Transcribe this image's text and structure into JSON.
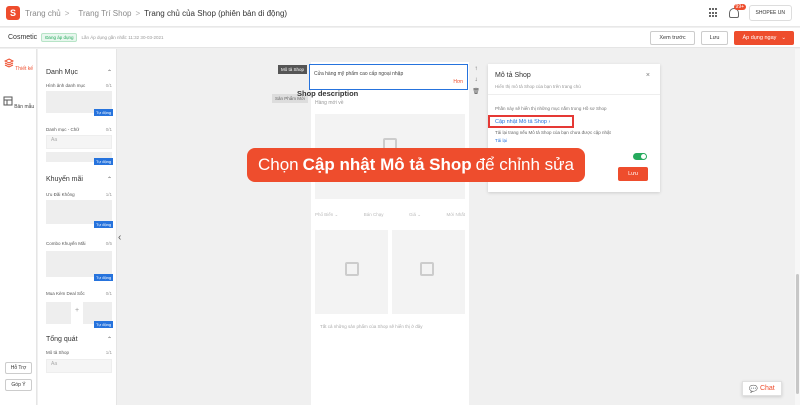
{
  "topbar": {
    "logo_glyph": "S",
    "crumbs": [
      "Trang chủ",
      "Trang Trí Shop",
      "Trang chủ của Shop (phiên bản di động)"
    ],
    "separator": ">",
    "notification_count": "99+",
    "user_label": "SHOPEE UN"
  },
  "subbar": {
    "theme_name": "Cosmetic",
    "applied_badge": "Đang áp dụng",
    "applied_time": "Lần Áp dụng gần nhất: 11:32 30-03-2021",
    "preview_label": "Xem trước",
    "save_label": "Lưu",
    "apply_label": "Áp dụng ngay",
    "apply_caret": "⌄"
  },
  "leftrail": {
    "design_label": "Thiết kế",
    "template_label": "Bản mẫu",
    "support_label": "Hỗ Trợ",
    "feedback_label": "Góp Ý"
  },
  "panel": {
    "categories_title": "Danh Mục",
    "caret": "⌃",
    "img_category_label": "Hình ảnh danh mục",
    "img_category_count": "0/1",
    "auto_tag": "Tự động",
    "category_text_label": "Danh mục - Chữ",
    "category_text_count": "0/1",
    "category_text_placeholder": "Aa",
    "promo_title": "Khuyến mãi",
    "voucher_label": "Ưu Đãi Không",
    "voucher_count": "1/1",
    "combo_label": "Combo Khuyến Mãi",
    "combo_count": "0/5",
    "deal_label": "Mua Kèm Deal Sốc",
    "deal_count": "0/1",
    "plus_sign": "+",
    "general_title": "Tổng quát",
    "shop_desc_label": "Mô tả Shop",
    "shop_desc_count": "1/1",
    "shop_desc_placeholder": "Aa",
    "collapse_glyph": "‹"
  },
  "canvas": {
    "desc_hover_label": "Mô tả Shop",
    "products_hover_label": "Sản Phẩm Mới",
    "desc_text": "Cửa hàng mỹ phẩm cao cấp ngoại nhập",
    "desc_more": "Hơn",
    "tool_up": "↑",
    "tool_down": "↓",
    "tool_delete": "🗑",
    "section_title": "Shop description",
    "new_label": "Hàng mới về",
    "filters": [
      "Phổ Biến ⌄",
      "Bán Chạy",
      "Giá ⌄",
      "Mới Nhất"
    ],
    "footer_note": "Tất cả những sản phẩm của Shop sẽ hiển thị ở đây"
  },
  "settings": {
    "title": "Mô tả Shop",
    "close": "×",
    "subtitle": "Hiển thị mô tả Shop của bạn trên trang chủ",
    "hint": "Phần này sẽ hiển thị những mục nằm trong Hồ sơ Shop",
    "update_link": "Cập nhật Mô tả Shop",
    "update_link_chevron": "›",
    "reload_text": "Tải lại trang nếu Mô tả Shop của bạn chưa được cập nhật",
    "reload_link": "Tải lại",
    "save_label": "Lưu"
  },
  "banner": {
    "prefix": "Chọn",
    "emphasis": "Cập nhật Mô tả Shop",
    "suffix": "để chỉnh sửa"
  },
  "chat": {
    "icon": "💬",
    "label": "Chat"
  },
  "colors": {
    "brand": "#ee4d2d",
    "link": "#2673dd",
    "success": "#26aa5d",
    "highlight_border": "#e53935"
  }
}
